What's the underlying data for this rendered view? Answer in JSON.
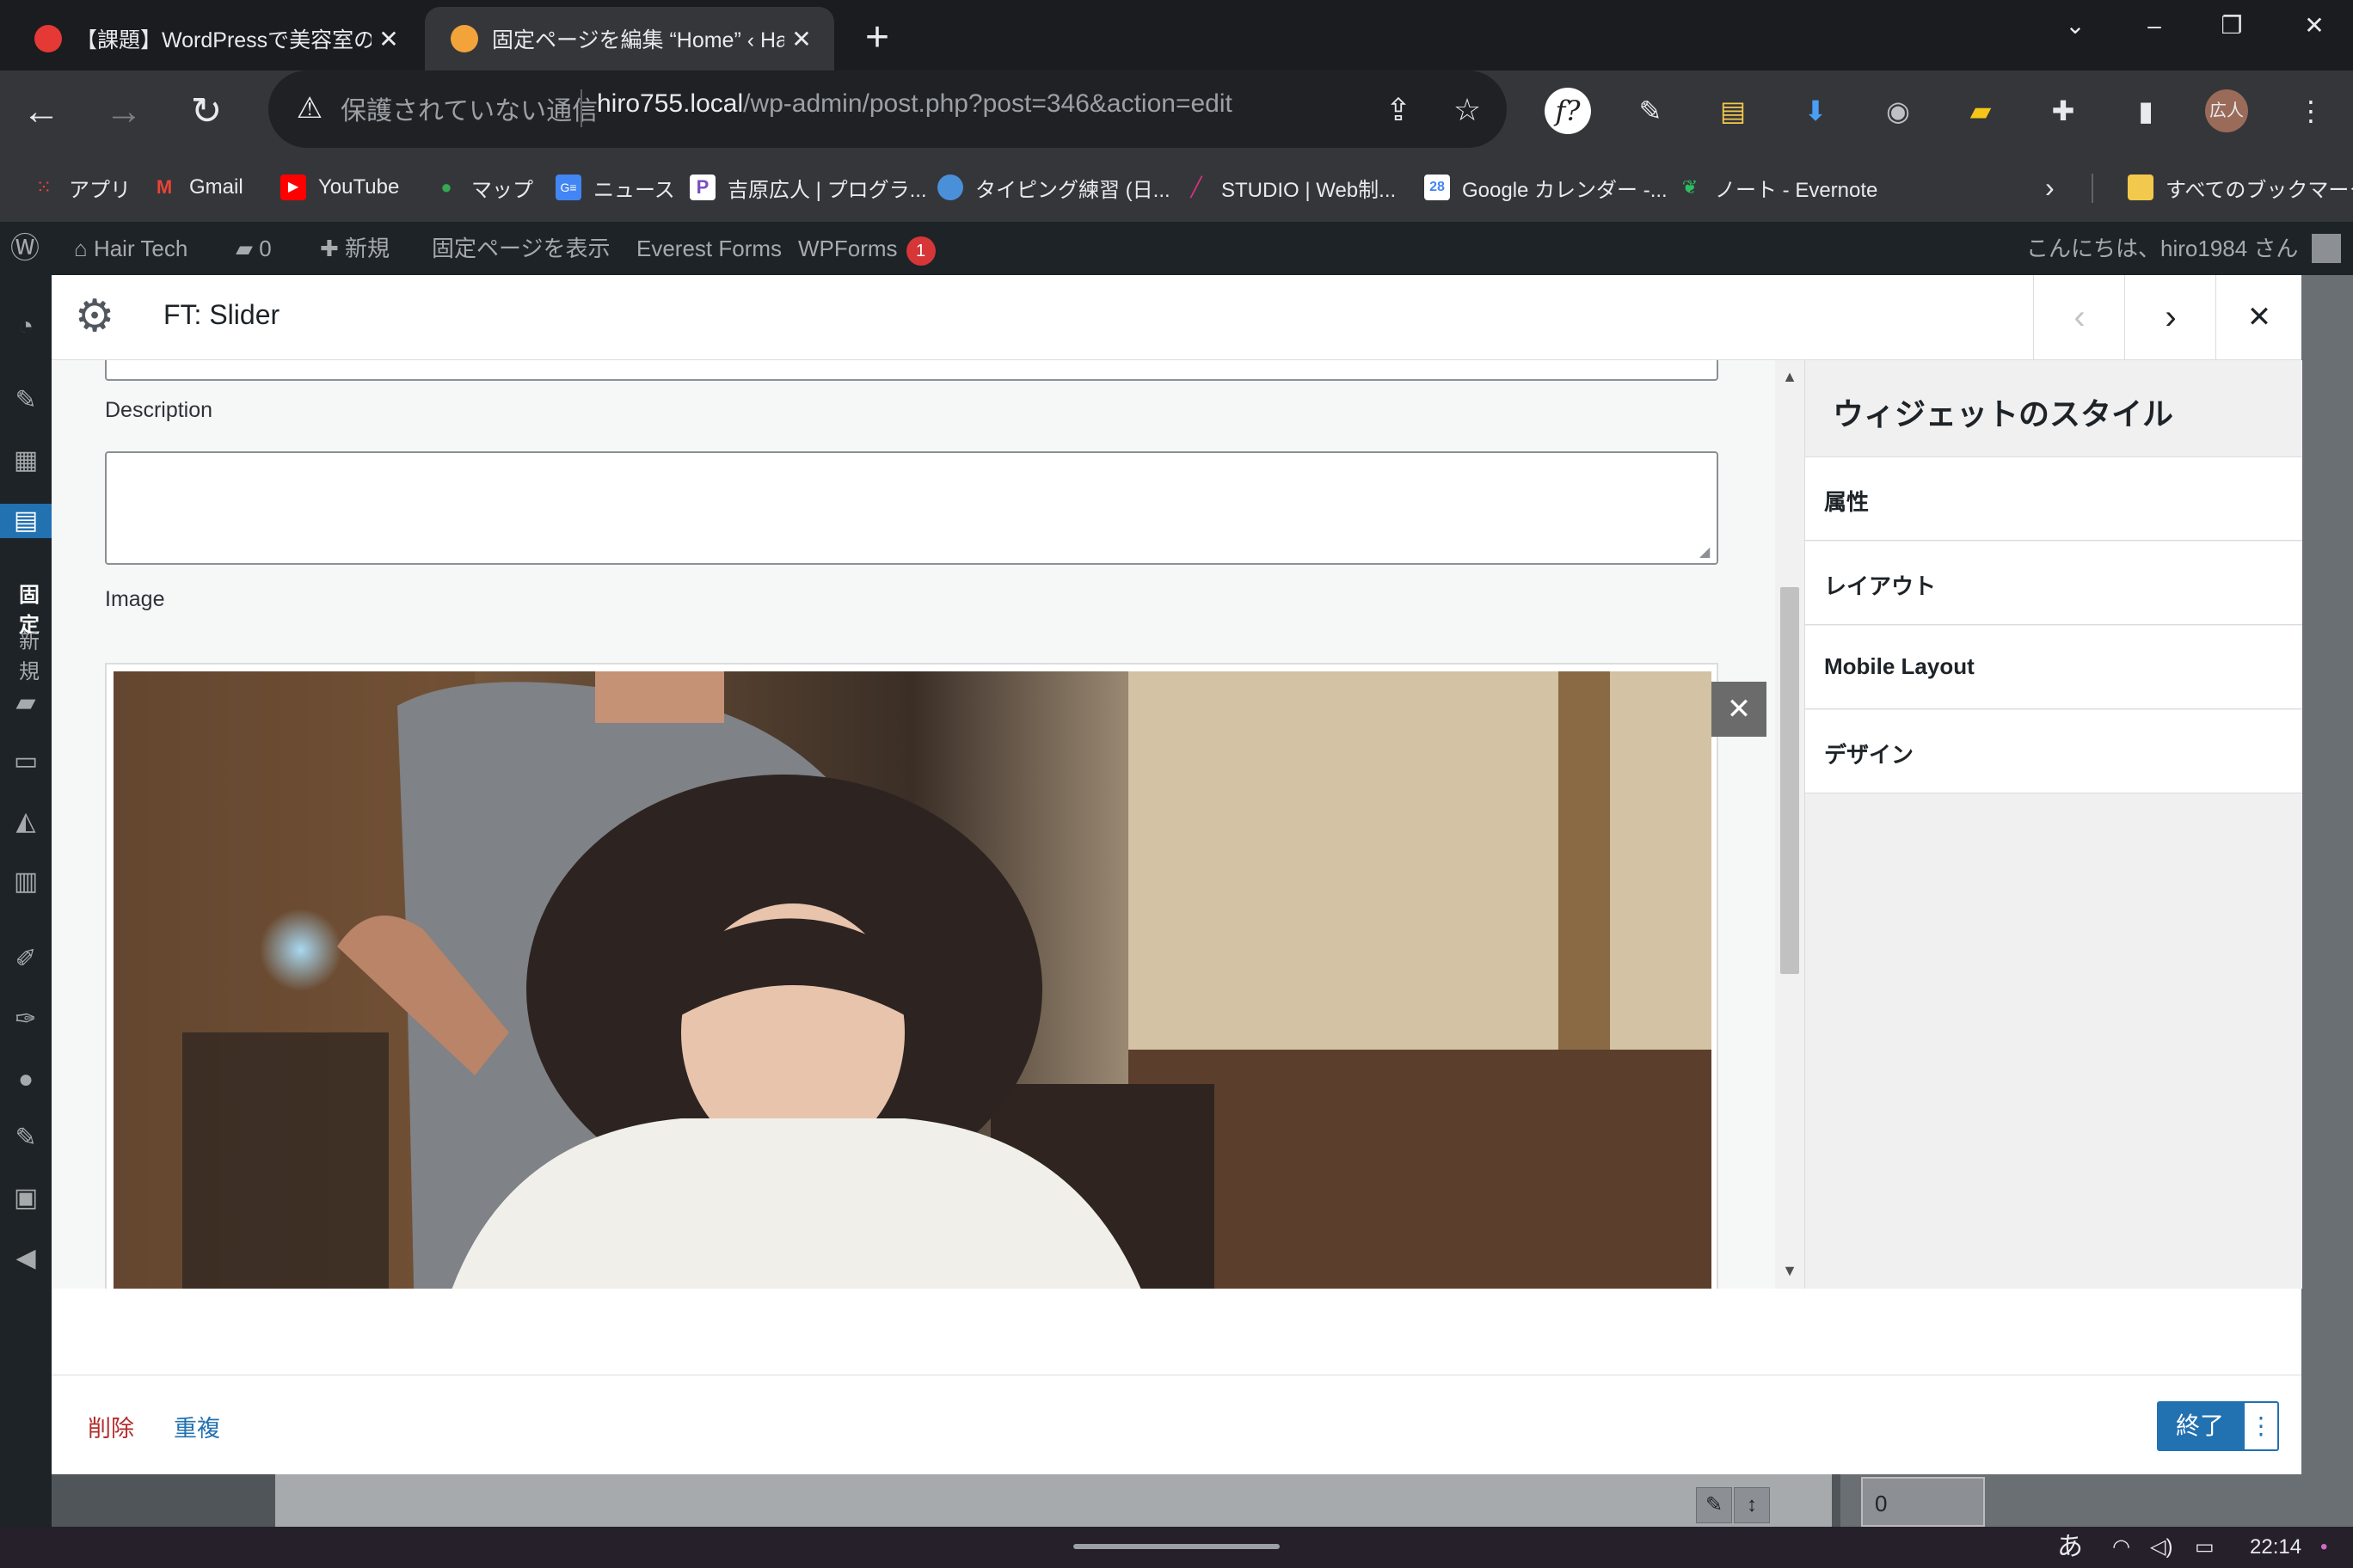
{
  "browser": {
    "tabs": [
      {
        "title": "【課題】WordPressで美容室のサ",
        "icon": "red-s-icon",
        "color": "#e53935"
      },
      {
        "title": "固定ページを編集 “Home” ‹ Ha",
        "icon": "orange-s-icon",
        "color": "#f2a33a"
      }
    ],
    "address": {
      "security_label": "保護されていない通信",
      "host": "hiro755.local",
      "path": "/wp-admin/post.php?post=346&action=edit"
    },
    "profile_label": "広人"
  },
  "bookmarks": [
    {
      "label": "アプリ",
      "icon": "apps-grid-icon",
      "color": "#ea4335"
    },
    {
      "label": "Gmail",
      "icon": "gmail-icon",
      "color": "#ea4335"
    },
    {
      "label": "YouTube",
      "icon": "youtube-icon",
      "color": "#ff0000"
    },
    {
      "label": "マップ",
      "icon": "maps-pin-icon",
      "color": "#34a853"
    },
    {
      "label": "ニュース",
      "icon": "news-icon",
      "color": "#4285f4"
    },
    {
      "label": "吉原広人 | プログラ...",
      "icon": "p-icon",
      "color": "#7b4fbf"
    },
    {
      "label": "タイピング練習 (日...",
      "icon": "typing-icon",
      "color": "#4a90d9"
    },
    {
      "label": "STUDIO | Web制...",
      "icon": "studio-icon",
      "color": "#d63384"
    },
    {
      "label": "Google カレンダー -...",
      "icon": "calendar-icon",
      "color": "#4285f4"
    },
    {
      "label": "ノート - Evernote",
      "icon": "evernote-icon",
      "color": "#2dbe60"
    }
  ],
  "bookmarks_all": "すべてのブックマーク",
  "wpbar": {
    "site": "Hair Tech",
    "comments": "0",
    "new": "新規",
    "view_page": "固定ページを表示",
    "everest": "Everest Forms",
    "wpforms": "WPForms",
    "wpforms_badge": "1",
    "greeting": "こんにちは、hiro1984 さん"
  },
  "background": {
    "side_text_1": "固定",
    "side_text_2": "新規",
    "input_value": "0"
  },
  "modal": {
    "title": "FT: Slider",
    "fields": {
      "description_label": "Description",
      "image_label": "Image"
    },
    "style_panel": {
      "title": "ウィジェットのスタイル",
      "items": [
        "属性",
        "レイアウト",
        "Mobile Layout",
        "デザイン"
      ]
    },
    "footer": {
      "delete": "削除",
      "duplicate": "重複",
      "done": "終了"
    }
  },
  "tray": {
    "ime": "あ",
    "time": "22:14"
  }
}
